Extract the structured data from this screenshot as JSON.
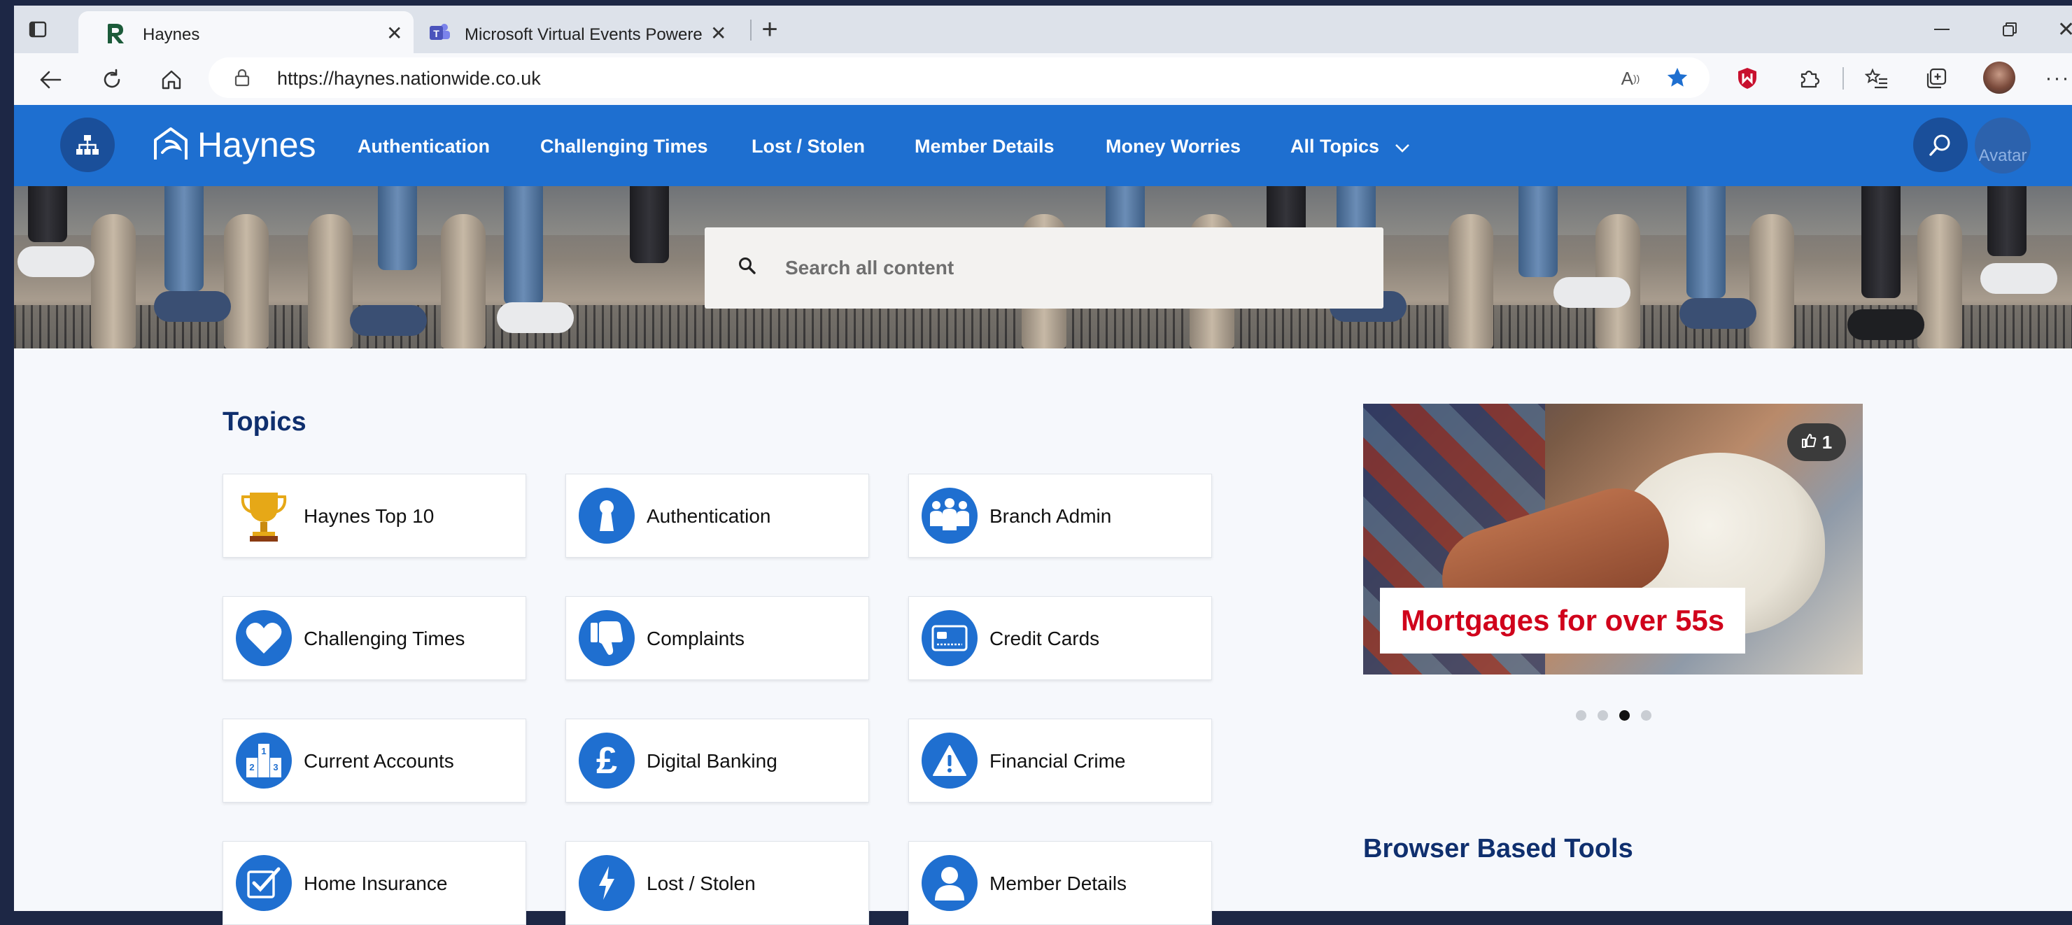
{
  "browser": {
    "tabs": [
      {
        "title": "Haynes",
        "active": true
      },
      {
        "title": "Microsoft Virtual Events Powered",
        "active": false
      }
    ],
    "url": "https://haynes.nationwide.co.uk"
  },
  "site": {
    "logo_text": "Haynes",
    "nav": [
      "Authentication",
      "Challenging Times",
      "Lost / Stolen",
      "Member Details",
      "Money Worries",
      "All Topics"
    ],
    "avatar_alt": "Avatar"
  },
  "search": {
    "placeholder": "Search all content"
  },
  "topics": {
    "heading": "Topics",
    "items": [
      {
        "label": "Haynes Top 10",
        "icon": "trophy-icon"
      },
      {
        "label": "Authentication",
        "icon": "keyhole-icon"
      },
      {
        "label": "Branch Admin",
        "icon": "people-group-icon"
      },
      {
        "label": "Challenging Times",
        "icon": "heart-icon"
      },
      {
        "label": "Complaints",
        "icon": "thumbs-down-icon"
      },
      {
        "label": "Credit Cards",
        "icon": "credit-card-icon"
      },
      {
        "label": "Current Accounts",
        "icon": "number-blocks-icon"
      },
      {
        "label": "Digital Banking",
        "icon": "pound-icon"
      },
      {
        "label": "Financial Crime",
        "icon": "warning-icon"
      },
      {
        "label": "Home Insurance",
        "icon": "checkbox-icon"
      },
      {
        "label": "Lost / Stolen",
        "icon": "lightning-icon"
      },
      {
        "label": "Member Details",
        "icon": "person-icon"
      }
    ]
  },
  "promo": {
    "title": "Mortgages for over 55s",
    "likes": "1",
    "active_slide": 3,
    "slides": 4
  },
  "tools": {
    "heading": "Browser Based Tools"
  },
  "colors": {
    "brand_blue": "#1e6fd0",
    "nav_dark": "#1a4f9a",
    "promo_red": "#d0021b",
    "heading_navy": "#0f2f6e"
  }
}
